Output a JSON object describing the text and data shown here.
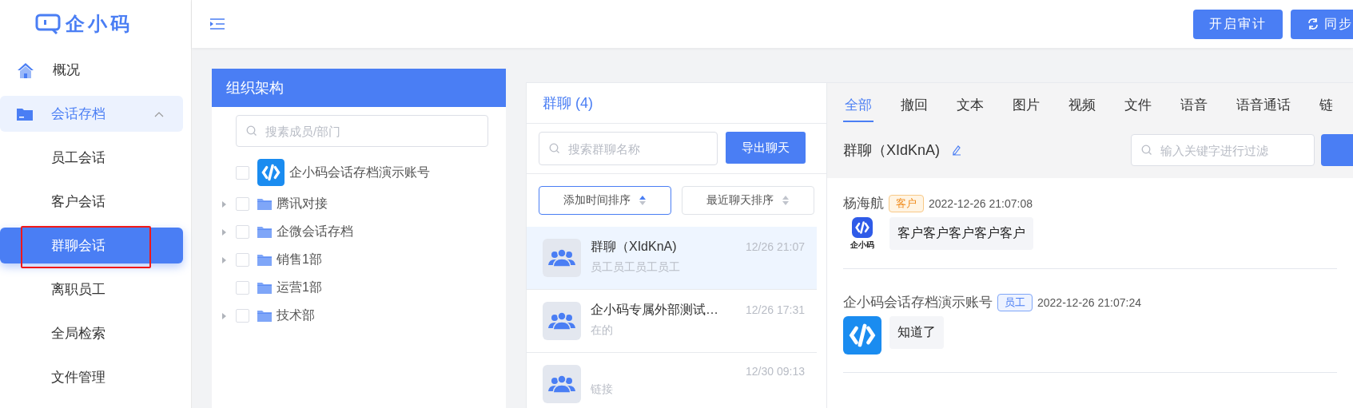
{
  "app": {
    "logo": "企小码"
  },
  "sidebar": {
    "items": [
      {
        "label": "概况",
        "kind": "home",
        "selected": false
      },
      {
        "label": "会话存档",
        "kind": "folder",
        "selected": false,
        "expanded": true,
        "children": [
          {
            "label": "员工会话",
            "selected": false,
            "annotated": false
          },
          {
            "label": "客户会话",
            "selected": false,
            "annotated": false
          },
          {
            "label": "群聊会话",
            "selected": true,
            "annotated": true
          },
          {
            "label": "离职员工",
            "selected": false,
            "annotated": false
          },
          {
            "label": "全局检索",
            "selected": false,
            "annotated": false
          },
          {
            "label": "文件管理",
            "selected": false,
            "annotated": false
          }
        ]
      }
    ]
  },
  "topbar": {
    "buttons": [
      {
        "label": "开启审计",
        "kind": "plain"
      },
      {
        "label": "同步",
        "kind": "sync"
      }
    ]
  },
  "org": {
    "title": "组织架构",
    "search": {
      "placeholder": "搜素成员/部门"
    },
    "tree": [
      {
        "label": "企小码会话存档演示账号",
        "kind": "account",
        "checked": false,
        "has_children": false
      },
      {
        "label": "腾讯对接",
        "kind": "dept",
        "checked": false,
        "has_children": true
      },
      {
        "label": "企微会话存档",
        "kind": "dept",
        "checked": false,
        "has_children": true
      },
      {
        "label": "销售1部",
        "kind": "dept",
        "checked": false,
        "has_children": true
      },
      {
        "label": "运营1部",
        "kind": "dept",
        "checked": false,
        "has_children": false
      },
      {
        "label": "技术部",
        "kind": "dept",
        "checked": false,
        "has_children": true
      }
    ]
  },
  "groups": {
    "title": "群聊 (4)",
    "search": {
      "placeholder": "搜索群聊名称"
    },
    "export_button": "导出聊天",
    "sorts": [
      {
        "label": "添加时间排序",
        "selected": true
      },
      {
        "label": "最近聊天排序",
        "selected": false
      }
    ],
    "items": [
      {
        "name": "群聊（XIdKnA)",
        "time": "12/26 21:07",
        "preview": "员工员工员工员工",
        "selected": true
      },
      {
        "name": "企小码专属外部测试…",
        "time": "12/26 17:31",
        "preview": "在的",
        "selected": false
      },
      {
        "time": "12/30 09:13",
        "preview": "链接",
        "selected": false
      }
    ]
  },
  "chat": {
    "tabs": [
      {
        "label": "全部",
        "selected": true
      },
      {
        "label": "撤回",
        "selected": false
      },
      {
        "label": "文本",
        "selected": false
      },
      {
        "label": "图片",
        "selected": false
      },
      {
        "label": "视频",
        "selected": false
      },
      {
        "label": "文件",
        "selected": false
      },
      {
        "label": "语音",
        "selected": false
      },
      {
        "label": "语音通话",
        "selected": false
      },
      {
        "label": "链",
        "selected": false
      }
    ],
    "title": "群聊（XIdKnA)",
    "filter": {
      "placeholder": "输入关键字进行过滤"
    },
    "messages": [
      {
        "sender": "杨海航",
        "role": "客户",
        "kind": "customer",
        "time": "2022-12-26 21:07:08",
        "avatar_caption": "企小码",
        "text": "客户客户客户客户客户"
      },
      {
        "sender": "企小码会话存档演示账号",
        "role": "员工",
        "kind": "staff",
        "time": "2022-12-26 21:07:24",
        "text": "知道了"
      }
    ]
  }
}
